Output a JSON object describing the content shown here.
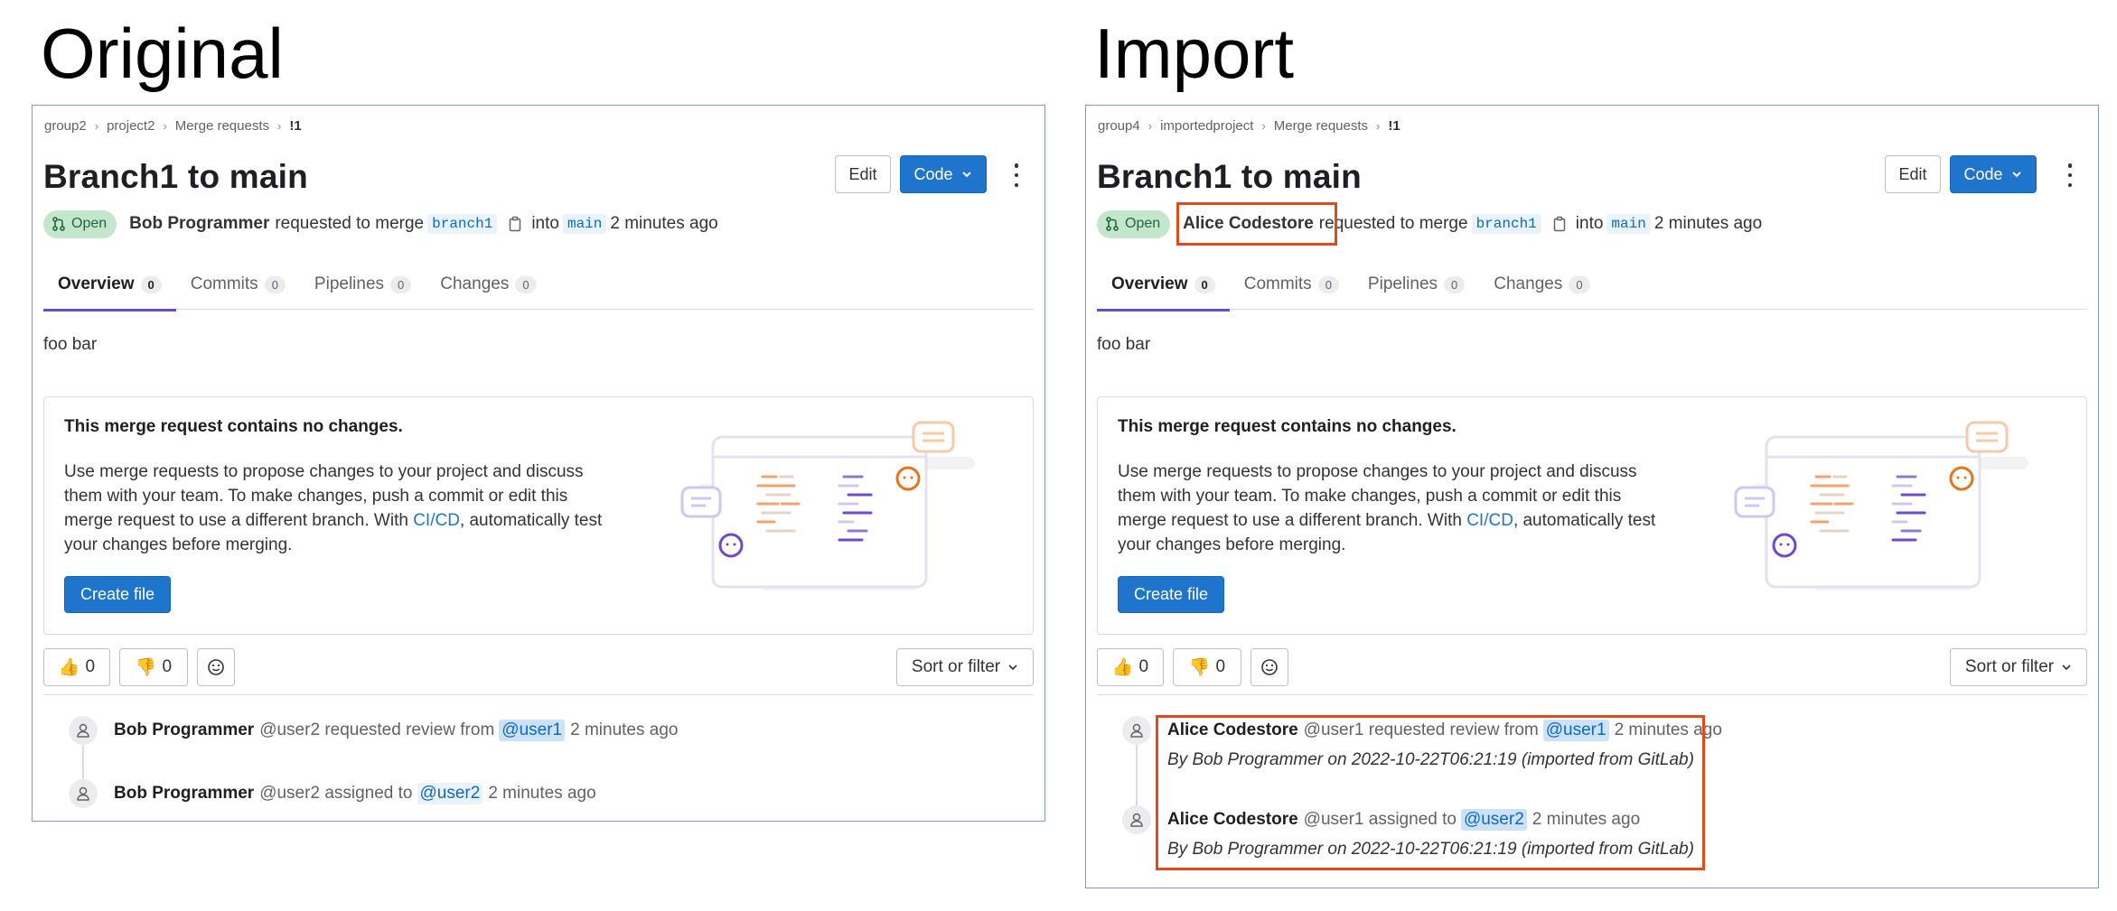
{
  "original": {
    "title": "Original",
    "breadcrumb": [
      "group2",
      "project2",
      "Merge requests",
      "!1"
    ],
    "mr_title": "Branch1 to main",
    "edit_label": "Edit",
    "code_label": "Code",
    "status": "Open",
    "author": "Bob Programmer",
    "requested_text": "requested to merge",
    "source_branch": "branch1",
    "into_text": "into",
    "target_branch": "main",
    "time": "2 minutes ago",
    "tabs": [
      {
        "label": "Overview",
        "count": "0"
      },
      {
        "label": "Commits",
        "count": "0"
      },
      {
        "label": "Pipelines",
        "count": "0"
      },
      {
        "label": "Changes",
        "count": "0"
      }
    ],
    "description": "foo bar",
    "empty_title": "This merge request contains no changes.",
    "empty_body_pre": "Use merge requests to propose changes to your project and discuss them with your team. To make changes, push a commit or edit this merge request to use a different branch. With ",
    "empty_link": "CI/CD",
    "empty_body_post": ", automatically test your changes before merging.",
    "create_file": "Create file",
    "thumbs_up_count": "0",
    "thumbs_down_count": "0",
    "sort_label": "Sort or filter",
    "notes": [
      {
        "author": "Bob Programmer",
        "handle": "@user2",
        "action": "requested review from",
        "mention": "@user1",
        "time": "2 minutes ago"
      },
      {
        "author": "Bob Programmer",
        "handle": "@user2",
        "action": "assigned to",
        "mention": "@user2",
        "time": "2 minutes ago"
      }
    ]
  },
  "import": {
    "title": "Import",
    "breadcrumb": [
      "group4",
      "importedproject",
      "Merge requests",
      "!1"
    ],
    "mr_title": "Branch1 to main",
    "edit_label": "Edit",
    "code_label": "Code",
    "status": "Open",
    "author": "Alice Codestore",
    "requested_text": "requested to merge",
    "source_branch": "branch1",
    "into_text": "into",
    "target_branch": "main",
    "time": "2 minutes ago",
    "tabs": [
      {
        "label": "Overview",
        "count": "0"
      },
      {
        "label": "Commits",
        "count": "0"
      },
      {
        "label": "Pipelines",
        "count": "0"
      },
      {
        "label": "Changes",
        "count": "0"
      }
    ],
    "description": "foo bar",
    "empty_title": "This merge request contains no changes.",
    "empty_body_pre": "Use merge requests to propose changes to your project and discuss them with your team. To make changes, push a commit or edit this merge request to use a different branch. With ",
    "empty_link": "CI/CD",
    "empty_body_post": ", automatically test your changes before merging.",
    "create_file": "Create file",
    "thumbs_up_count": "0",
    "thumbs_down_count": "0",
    "sort_label": "Sort or filter",
    "notes": [
      {
        "author": "Alice Codestore",
        "handle": "@user1",
        "action": "requested review from",
        "mention": "@user1",
        "time": "2 minutes ago",
        "sub": "By Bob Programmer on 2022-10-22T06:21:19 (imported from GitLab)"
      },
      {
        "author": "Alice Codestore",
        "handle": "@user1",
        "action": "assigned to",
        "mention": "@user2",
        "time": "2 minutes ago",
        "sub": "By Bob Programmer on 2022-10-22T06:21:19 (imported from GitLab)"
      }
    ]
  },
  "colors": {
    "highlight": "#e24a1c",
    "primary": "#1f75cb",
    "open_badge": "#c3e6cd"
  }
}
